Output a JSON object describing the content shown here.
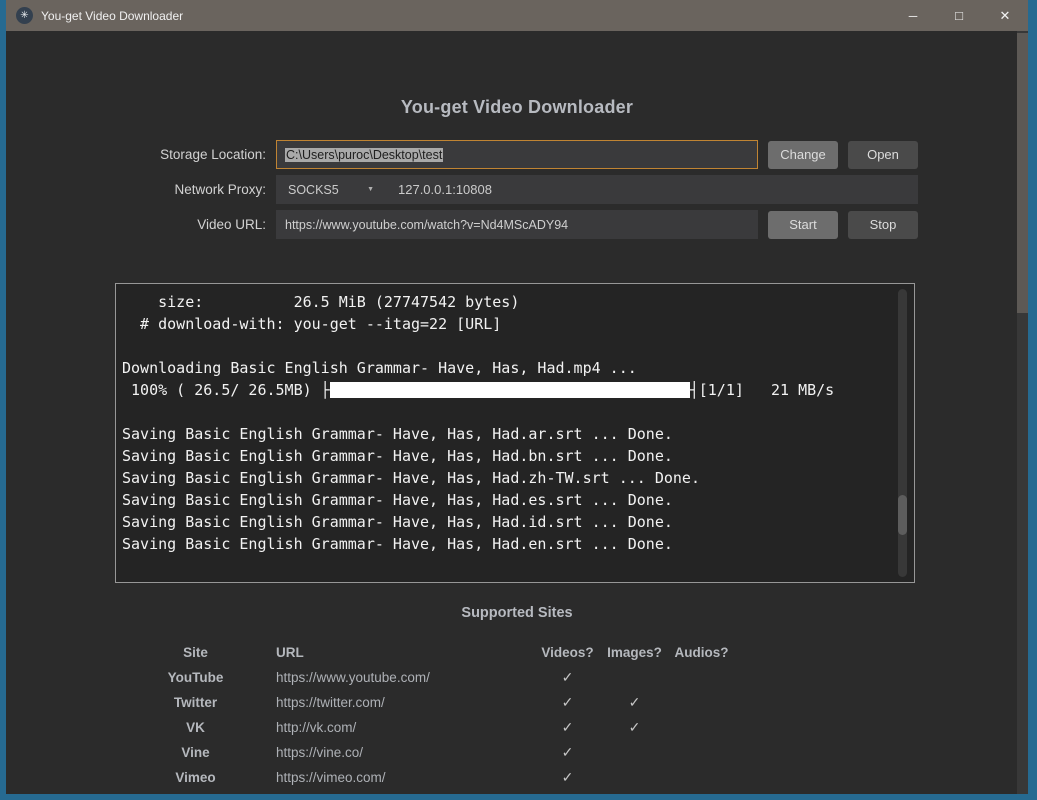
{
  "titlebar": {
    "title": "You-get Video Downloader"
  },
  "icons": {
    "app": "✳",
    "minimize": "─",
    "maximize": "□",
    "close": "✕",
    "dropdown": "▼"
  },
  "header": {
    "title": "You-get Video Downloader"
  },
  "form": {
    "storage": {
      "label": "Storage Location:",
      "value": "C:\\Users\\puroc\\Desktop\\test",
      "change_label": "Change",
      "open_label": "Open"
    },
    "proxy": {
      "label": "Network Proxy:",
      "type": "SOCKS5",
      "address": "127.0.0.1:10808"
    },
    "url": {
      "label": "Video URL:",
      "value": "https://www.youtube.com/watch?v=Nd4MScADY94",
      "start_label": "Start",
      "stop_label": "Stop"
    }
  },
  "console": {
    "lines": [
      "    size:          26.5 MiB (27747542 bytes)",
      "  # download-with: you-get --itag=22 [URL]",
      "",
      "Downloading Basic English Grammar- Have, Has, Had.mp4 ...",
      {
        "type": "progress",
        "prefix": " 100% ( 26.5/ 26.5MB) ├",
        "suffix": "┤[1/1]   21 MB/s",
        "percent": 100,
        "size_done_mb": 26.5,
        "size_total_mb": 26.5,
        "part": "1/1",
        "speed": "21 MB/s"
      },
      "",
      "Saving Basic English Grammar- Have, Has, Had.ar.srt ... Done.",
      "Saving Basic English Grammar- Have, Has, Had.bn.srt ... Done.",
      "Saving Basic English Grammar- Have, Has, Had.zh-TW.srt ... Done.",
      "Saving Basic English Grammar- Have, Has, Had.es.srt ... Done.",
      "Saving Basic English Grammar- Have, Has, Had.id.srt ... Done.",
      "Saving Basic English Grammar- Have, Has, Had.en.srt ... Done."
    ]
  },
  "supported_sites": {
    "title": "Supported Sites",
    "headers": {
      "site": "Site",
      "url": "URL",
      "videos": "Videos?",
      "images": "Images?",
      "audios": "Audios?"
    },
    "rows": [
      {
        "site": "YouTube",
        "url": "https://www.youtube.com/",
        "videos": "✓",
        "images": "",
        "audios": ""
      },
      {
        "site": "Twitter",
        "url": "https://twitter.com/",
        "videos": "✓",
        "images": "✓",
        "audios": ""
      },
      {
        "site": "VK",
        "url": "http://vk.com/",
        "videos": "✓",
        "images": "✓",
        "audios": ""
      },
      {
        "site": "Vine",
        "url": "https://vine.co/",
        "videos": "✓",
        "images": "",
        "audios": ""
      },
      {
        "site": "Vimeo",
        "url": "https://vimeo.com/",
        "videos": "✓",
        "images": "",
        "audios": ""
      }
    ]
  },
  "colors": {
    "window_edge": "#266a91",
    "titlebar": "#6a645e",
    "page_background": "#2b2b2b",
    "field_background": "#3a3a3c",
    "focus_border": "#c08433",
    "button_light": "#6d6d6d",
    "button_dark": "#4a4a4a",
    "console_background": "#242424"
  }
}
